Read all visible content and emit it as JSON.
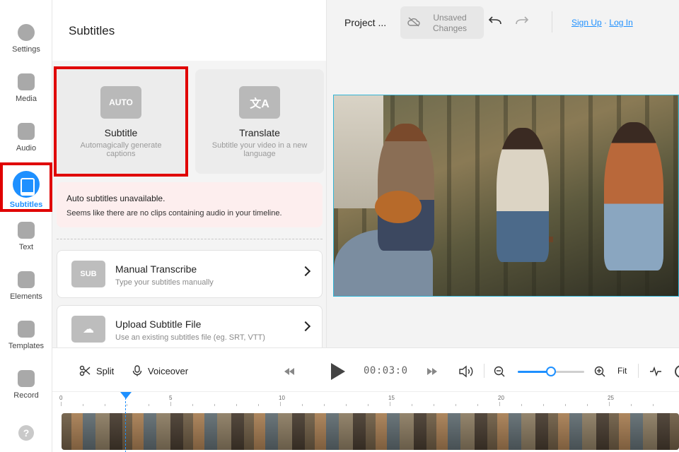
{
  "sidebar": {
    "items": [
      {
        "label": "Settings",
        "icon": "gear-icon"
      },
      {
        "label": "Media",
        "icon": "plus-icon"
      },
      {
        "label": "Audio",
        "icon": "music-note-icon"
      },
      {
        "label": "Subtitles",
        "icon": "subtitles-icon",
        "active": true
      },
      {
        "label": "Text",
        "icon": "text-icon"
      },
      {
        "label": "Elements",
        "icon": "shapes-icon"
      },
      {
        "label": "Templates",
        "icon": "layout-icon"
      },
      {
        "label": "Record",
        "icon": "camera-icon"
      }
    ],
    "help": "?"
  },
  "panel": {
    "title": "Subtitles",
    "options": [
      {
        "icon_text": "AUTO",
        "title": "Subtitle",
        "desc": "Automagically generate captions"
      },
      {
        "icon_text": "文A",
        "title": "Translate",
        "desc": "Subtitle your video in a new language"
      }
    ],
    "warning": {
      "title": "Auto subtitles unavailable.",
      "message": "Seems like there are no clips containing audio in your timeline."
    },
    "list": [
      {
        "icon_text": "SUB",
        "title": "Manual Transcribe",
        "desc": "Type your subtitles manually"
      },
      {
        "icon_text": "☁",
        "title": "Upload Subtitle File",
        "desc": "Use an existing subtitles file (eg. SRT, VTT)"
      }
    ]
  },
  "topbar": {
    "project": "Project ...",
    "unsaved_line1": "Unsaved",
    "unsaved_line2": "Changes",
    "sign_up": "Sign Up",
    "separator": "·",
    "log_in": "Log In"
  },
  "toolbar": {
    "split": "Split",
    "voiceover": "Voiceover",
    "time": "00:03:0",
    "fit": "Fit",
    "zoom_level": 0.5
  },
  "timeline": {
    "ticks": [
      "0",
      "5",
      "10",
      "15",
      "20",
      "25"
    ]
  },
  "colors": {
    "accent": "#1e90ff",
    "highlight": "#e00000"
  }
}
